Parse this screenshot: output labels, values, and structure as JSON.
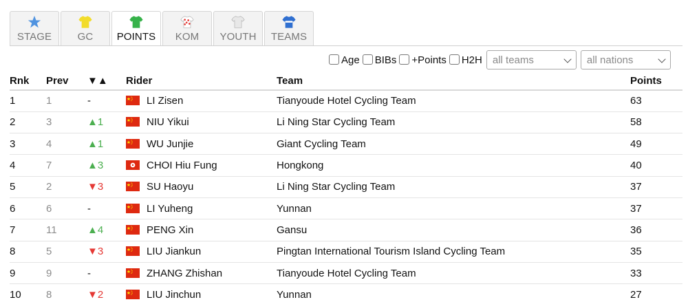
{
  "tabs": [
    {
      "label": "STAGE",
      "icon": "star-icon",
      "color": "#4f93e0",
      "active": false
    },
    {
      "label": "GC",
      "icon": "yellow-jersey-icon",
      "color": "#f2dc2a",
      "active": false
    },
    {
      "label": "POINTS",
      "icon": "green-jersey-icon",
      "color": "#36b24a",
      "active": true
    },
    {
      "label": "KOM",
      "icon": "polka-jersey-icon",
      "color": "#e53935",
      "active": false
    },
    {
      "label": "YOUTH",
      "icon": "white-jersey-icon",
      "color": "#e8e8e8",
      "active": false
    },
    {
      "label": "TEAMS",
      "icon": "blue-jersey-icon",
      "color": "#2f6fd0",
      "active": false
    }
  ],
  "filters": {
    "age": "Age",
    "bibs": "BIBs",
    "points": "+Points",
    "h2h": "H2H",
    "team_select": "all teams",
    "nation_select": "all nations"
  },
  "headers": {
    "rnk": "Rnk",
    "prev": "Prev",
    "change": "▼▲",
    "rider": "Rider",
    "team": "Team",
    "points": "Points"
  },
  "colors": {
    "up": "#4caf50",
    "down": "#e53935"
  },
  "rows": [
    {
      "rnk": "1",
      "prev": "1",
      "change": "-",
      "dir": "none",
      "flag": "CN",
      "rider": "LI Zisen",
      "team": "Tianyoude Hotel Cycling Team",
      "points": "63"
    },
    {
      "rnk": "2",
      "prev": "3",
      "change": "▲1",
      "dir": "up",
      "flag": "CN",
      "rider": "NIU Yikui",
      "team": "Li Ning Star Cycling Team",
      "points": "58"
    },
    {
      "rnk": "3",
      "prev": "4",
      "change": "▲1",
      "dir": "up",
      "flag": "CN",
      "rider": "WU Junjie",
      "team": "Giant Cycling Team",
      "points": "49"
    },
    {
      "rnk": "4",
      "prev": "7",
      "change": "▲3",
      "dir": "up",
      "flag": "HK",
      "rider": "CHOI Hiu Fung",
      "team": "Hongkong",
      "points": "40"
    },
    {
      "rnk": "5",
      "prev": "2",
      "change": "▼3",
      "dir": "down",
      "flag": "CN",
      "rider": "SU Haoyu",
      "team": "Li Ning Star Cycling Team",
      "points": "37"
    },
    {
      "rnk": "6",
      "prev": "6",
      "change": "-",
      "dir": "none",
      "flag": "CN",
      "rider": "LI Yuheng",
      "team": "Yunnan",
      "points": "37"
    },
    {
      "rnk": "7",
      "prev": "11",
      "change": "▲4",
      "dir": "up",
      "flag": "CN",
      "rider": "PENG Xin",
      "team": "Gansu",
      "points": "36"
    },
    {
      "rnk": "8",
      "prev": "5",
      "change": "▼3",
      "dir": "down",
      "flag": "CN",
      "rider": "LIU Jiankun",
      "team": "Pingtan International Tourism Island Cycling Team",
      "points": "35"
    },
    {
      "rnk": "9",
      "prev": "9",
      "change": "-",
      "dir": "none",
      "flag": "CN",
      "rider": "ZHANG Zhishan",
      "team": "Tianyoude Hotel Cycling Team",
      "points": "33"
    },
    {
      "rnk": "10",
      "prev": "8",
      "change": "▼2",
      "dir": "down",
      "flag": "CN",
      "rider": "LIU Jinchun",
      "team": "Yunnan",
      "points": "27"
    }
  ]
}
